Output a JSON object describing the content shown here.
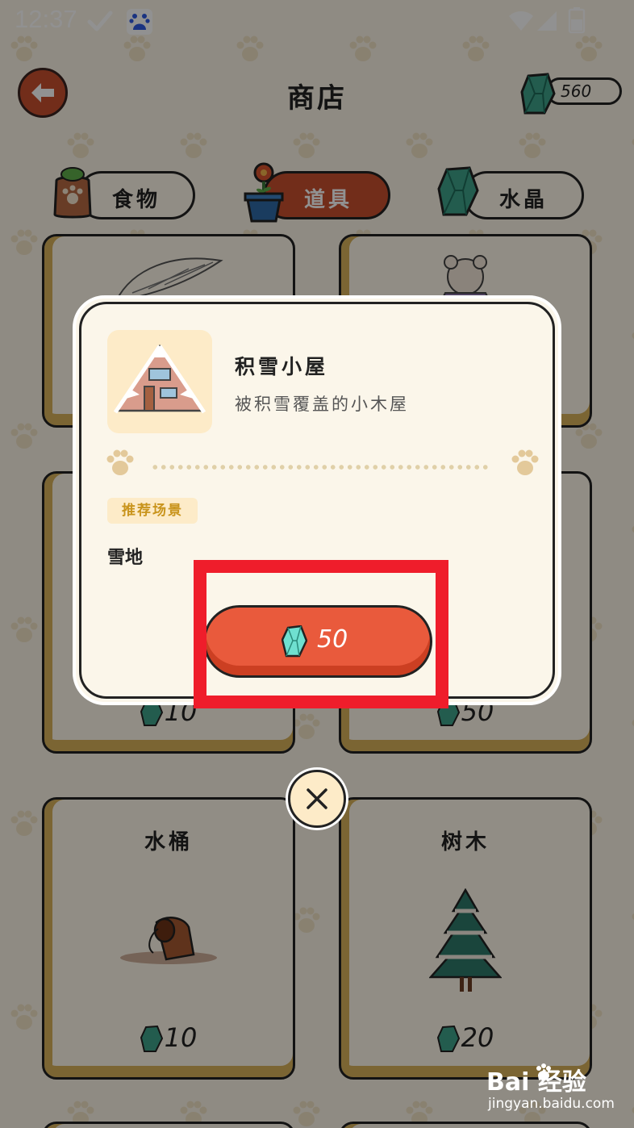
{
  "status_bar": {
    "time": "12:37",
    "icons": [
      "check-icon",
      "baidu-app-icon",
      "wifi-icon",
      "signal-icon",
      "battery-icon"
    ]
  },
  "header": {
    "title": "商店",
    "crystal_balance": "560",
    "back_icon": "back-arrow-icon"
  },
  "tabs": [
    {
      "label": "食物",
      "icon": "food-bag-icon",
      "active": false
    },
    {
      "label": "道具",
      "icon": "flower-pot-icon",
      "active": true
    },
    {
      "label": "水晶",
      "icon": "crystal-icon",
      "active": false
    }
  ],
  "cards": [
    {
      "name": "水桶",
      "price": "10",
      "icon": "bucket-icon"
    },
    {
      "name": "树木",
      "price": "20",
      "icon": "pine-tree-icon"
    },
    {
      "price": "10"
    },
    {
      "price": "50"
    }
  ],
  "modal": {
    "item_name": "积雪小屋",
    "item_description": "被积雪覆盖的小木屋",
    "item_icon": "snow-cabin-icon",
    "scene_label": "推荐场景",
    "scene_value": "雪地",
    "buy_price": "50",
    "close_icon": "close-icon"
  },
  "watermark": {
    "brand": "Bai 经验",
    "url": "jingyan.baidu.com"
  },
  "colors": {
    "accent": "#c9502e",
    "buy_button": "#e95a3c",
    "highlight": "#ef1d2b",
    "card_edge": "#d8b25a",
    "background": "#fbf4e6"
  }
}
